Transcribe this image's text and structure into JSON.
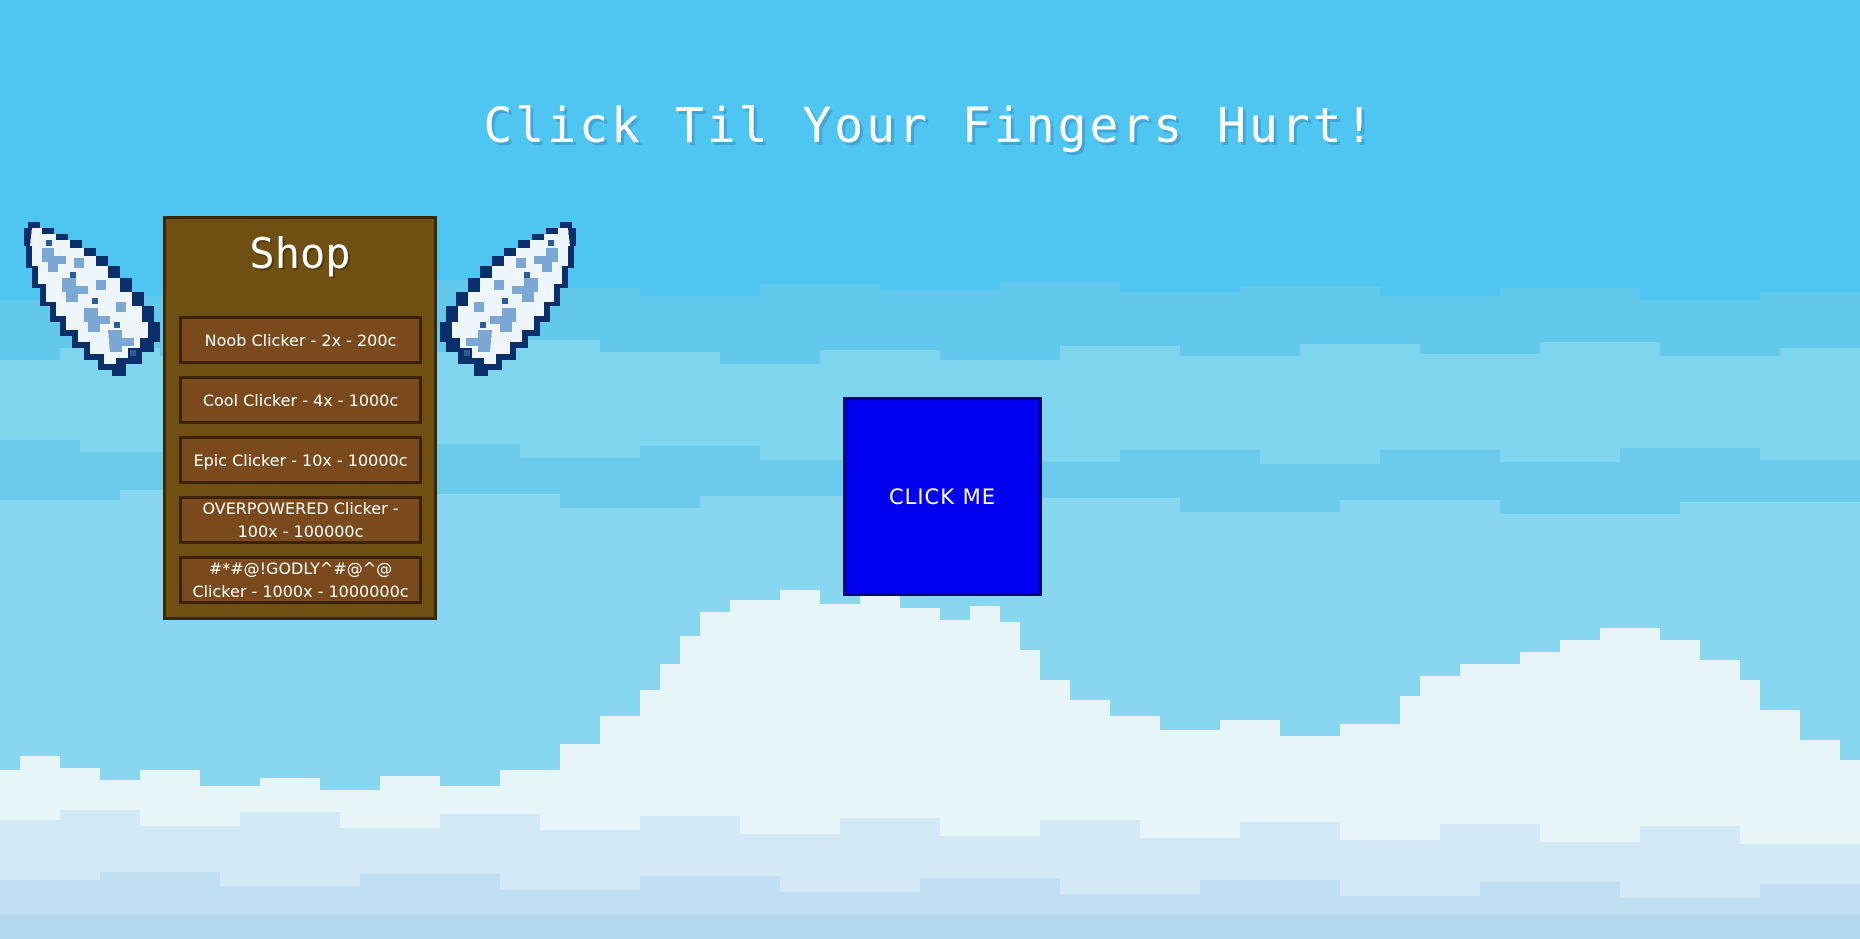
{
  "page": {
    "title": "Click Til Your Fingers Hurt!"
  },
  "shop": {
    "title": "Shop",
    "items": [
      {
        "label": "Noob Clicker - 2x - 200c"
      },
      {
        "label": "Cool Clicker - 4x - 1000c"
      },
      {
        "label": "Epic Clicker - 10x - 10000c"
      },
      {
        "label": "OVERPOWERED Clicker - 100x - 100000c"
      },
      {
        "label": "#*#@!GODLY^#@^@ Clicker - 1000x - 1000000c"
      }
    ]
  },
  "click_button": {
    "label": "CLICK ME"
  },
  "icons": {
    "wing_left": "angel-wing-icon",
    "wing_right": "angel-wing-icon"
  },
  "colors": {
    "sky": "#4fc6f2",
    "shop_bg": "#704f12",
    "shop_item_bg": "#7b4a1c",
    "click_button_bg": "#0000f0"
  }
}
